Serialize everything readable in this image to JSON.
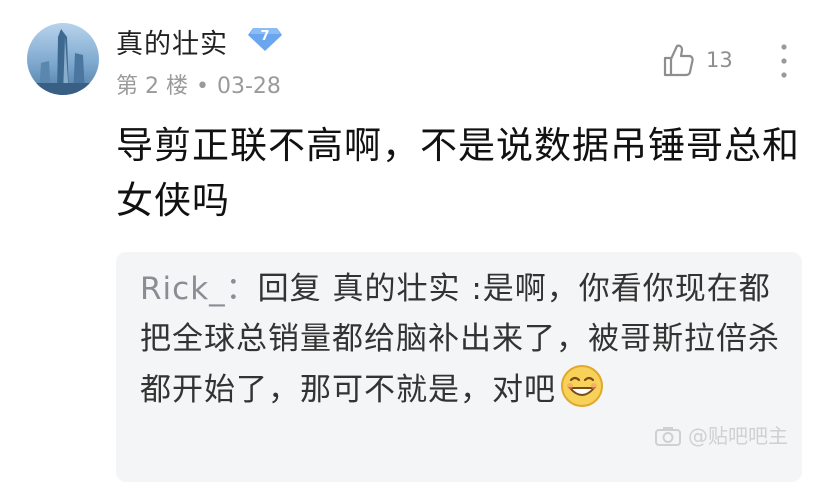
{
  "post": {
    "username": "真的壮实",
    "level": "7",
    "floor": "第 2 楼",
    "separator": "•",
    "date": "03-28",
    "like_count": "13",
    "content": "导剪正联不高啊，不是说数据吊锤哥总和女侠吗"
  },
  "reply": {
    "author": "Rick_",
    "colon": "：",
    "text": "回复 真的壮实 :是啊，你看你现在都把全球总销量都给脑补出来了，被哥斯拉倍杀都开始了，那可不就是，对吧"
  },
  "watermark": "@贴吧吧主",
  "icons": {
    "like": "thumbs-up-icon",
    "more": "more-vertical-icon",
    "level_badge": "diamond-level-icon",
    "emoji": "grinning-emoji-icon"
  },
  "colors": {
    "badge": "#6aa6f0",
    "meta": "#9a9a9a",
    "reply_bg": "#f4f5f6"
  }
}
